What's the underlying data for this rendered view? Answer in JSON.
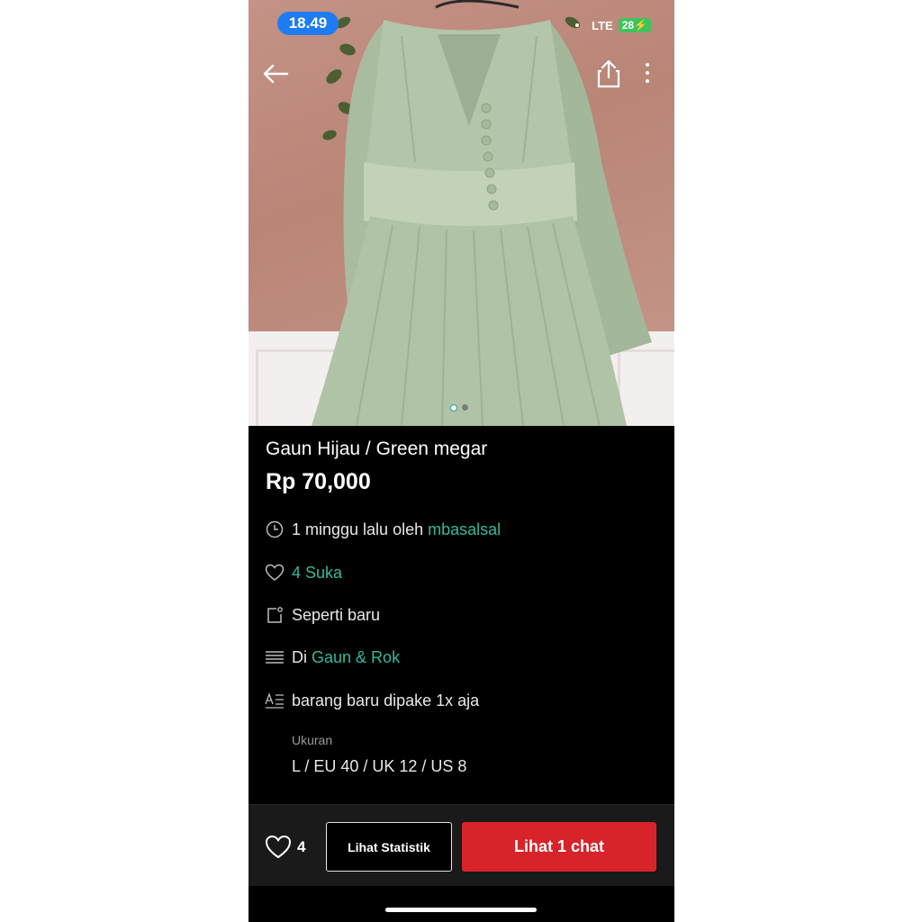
{
  "status_bar": {
    "time": "18.49",
    "network": "LTE",
    "battery": "28"
  },
  "nav": {
    "back_icon": "arrow-left-icon",
    "share_icon": "share-icon",
    "more_icon": "more-vertical-icon"
  },
  "gallery": {
    "image_count": 2,
    "active_index": 0
  },
  "product": {
    "title": "Gaun Hijau / Green megar",
    "price": "Rp 70,000",
    "posted_prefix": "1 minggu lalu oleh",
    "seller": "mbasalsal",
    "likes_text": "4 Suka",
    "condition": "Seperti baru",
    "category_prefix": "Di",
    "category": "Gaun & Rok",
    "description": "barang baru dipake 1x aja",
    "size_label": "Ukuran",
    "size_value": "L / EU 40 / UK 12 / US 8"
  },
  "bottom_bar": {
    "like_count": "4",
    "stats_button": "Lihat Statistik",
    "chat_button": "Lihat 1 chat"
  },
  "colors": {
    "accent_link": "#36b89a",
    "chat_button": "#d8232a",
    "time_pill": "#1e7cf2"
  }
}
